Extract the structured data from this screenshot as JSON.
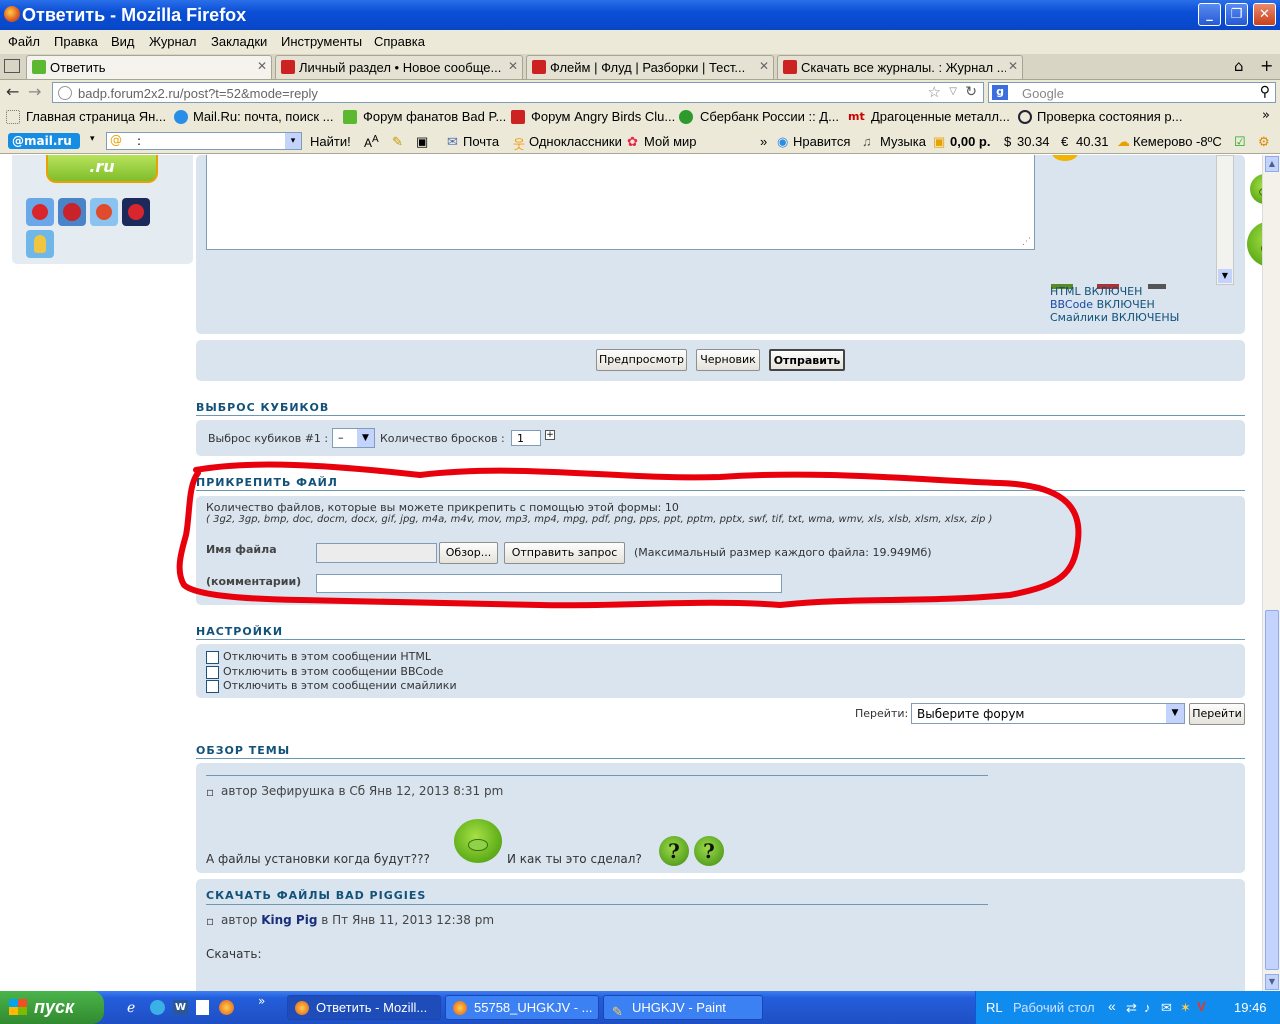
{
  "window": {
    "title": "Ответить - Mozilla Firefox"
  },
  "menu": [
    "Файл",
    "Правка",
    "Вид",
    "Журнал",
    "Закладки",
    "Инструменты",
    "Справка"
  ],
  "tabs": [
    {
      "label": "Ответить",
      "active": true
    },
    {
      "label": "Личный раздел • Новое сообще...",
      "active": false
    },
    {
      "label": "Флейм | Флуд | Разборки | Тест...",
      "active": false
    },
    {
      "label": "Скачать все журналы. : Журнал ...",
      "active": false
    }
  ],
  "nav": {
    "url": "badp.forum2x2.ru/post?t=52&mode=reply",
    "search_placeholder": "Google"
  },
  "bookmarks": [
    "Главная страница Ян...",
    "Mail.Ru: почта, поиск ...",
    "Форум фанатов Bad P...",
    "Форум Angry Birds Clu...",
    "Сбербанк России :: Д...",
    "Драгоценные металл...",
    "Проверка состояния р..."
  ],
  "mailbar": {
    "logo": "@mail.ru",
    "search_value": ":",
    "find": "Найти!",
    "mail": "Почта",
    "ok": "Одноклассники",
    "mymir": "Мой мир",
    "like": "Нравится",
    "music": "Музыка",
    "balance": "0,00 р.",
    "usd": "30.34",
    "eur": "40.31",
    "weather": "Кемерово -8ºC"
  },
  "sidebar_logo_text": ".ru",
  "editor_status": {
    "html": "HTML ВКЛЮЧЕН",
    "bbcode_label": "BBCode",
    "bbcode_state": "ВКЛЮЧЕН",
    "smilies": "Смайлики ВКЛЮЧЕНЫ"
  },
  "actions": {
    "preview": "Предпросмотр",
    "draft": "Черновик",
    "submit": "Отправить"
  },
  "dice": {
    "header": "ВЫБРОС КУБИКОВ",
    "label": "Выброс кубиков #1 :",
    "select": "–",
    "count_label": "Количество бросков :",
    "count_value": "1"
  },
  "attach": {
    "header": "ПРИКРЕПИТЬ ФАЙЛ",
    "count_text": "Количество файлов, которые вы можете прикрепить с помощью этой формы: 10",
    "ext_text": "( 3g2, 3gp, bmp, doc, docm, docx, gif, jpg, m4a, m4v, mov, mp3, mp4, mpg, pdf, png, pps, ppt, pptm, pptx, swf, tif, txt, wma, wmv, xls, xlsb, xlsm, xlsx, zip )",
    "filename_label": "Имя файла",
    "browse": "Обзор...",
    "send": "Отправить запрос",
    "max_size": "(Максимальный размер каждого файла: 19.949Мб)",
    "comment_label": "(комментарии)"
  },
  "settings": {
    "header": "НАСТРОЙКИ",
    "options": [
      "Отключить в этом сообщении HTML",
      "Отключить в этом сообщении BBCode",
      "Отключить в этом сообщении смайлики"
    ]
  },
  "jump": {
    "label": "Перейти:",
    "select": "Выберите форум",
    "button": "Перейти"
  },
  "review": {
    "header": "ОБЗОР ТЕМЫ",
    "post1": {
      "meta": "автор Зефирушка в Сб Янв 12, 2013 8:31 pm",
      "text1": "А файлы установки когда будут???",
      "text2": "И как ты это сделал?",
      "q1": "?",
      "q2": "?"
    },
    "post2": {
      "title": "СКАЧАТЬ ФАЙЛЫ BAD PIGGIES",
      "meta_prefix": "автор",
      "author": "King Pig",
      "meta_suffix": "в Пт Янв 11, 2013 12:38 pm",
      "text": "Скачать:"
    }
  },
  "taskbar": {
    "start": "пуск",
    "tasks": [
      "Ответить - Mozill...",
      "55758_UHGKJV - ...",
      "UHGKJV - Paint"
    ],
    "lang": "RL",
    "desktop": "Рабочий стол",
    "clock": "19:46"
  },
  "colors": {
    "annotation": "#e8000c",
    "panel": "#d9e4ee",
    "header_text": "#12527a",
    "titlebar": "#0a4fd6"
  }
}
